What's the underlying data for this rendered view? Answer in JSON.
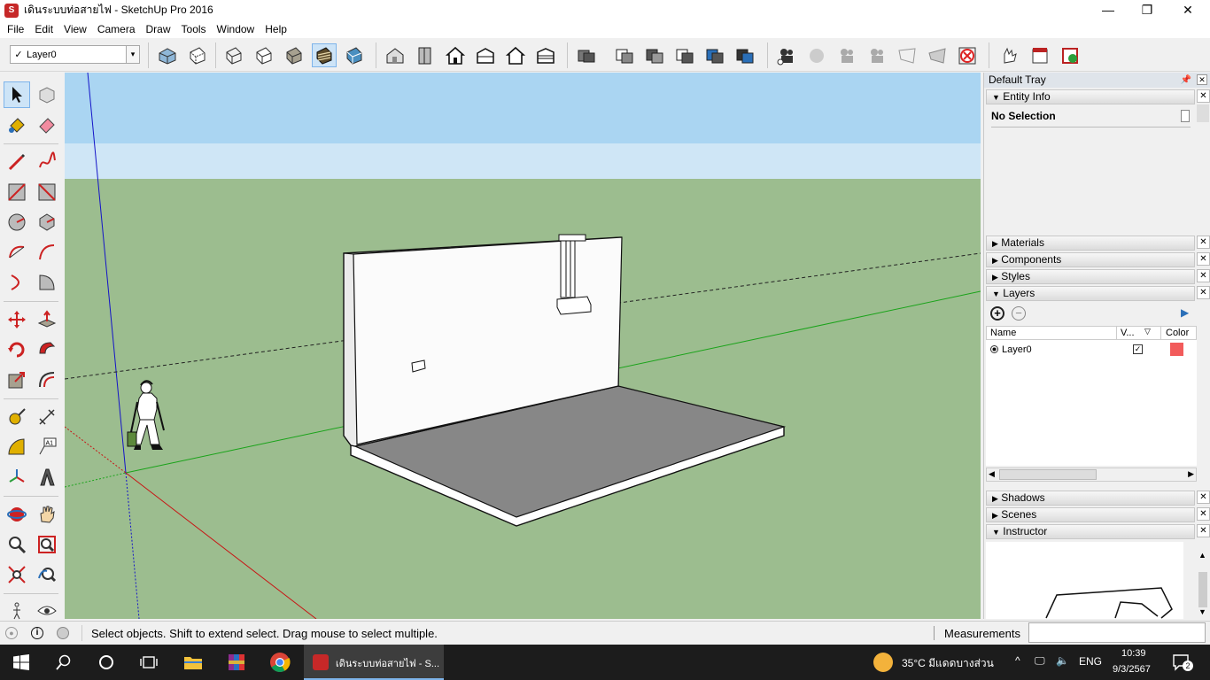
{
  "window": {
    "title": "เดินระบบท่อสายไฟ - SketchUp Pro 2016",
    "minimize": "—",
    "maximize": "❐",
    "close": "✕"
  },
  "menu": [
    "File",
    "Edit",
    "View",
    "Camera",
    "Draw",
    "Tools",
    "Window",
    "Help"
  ],
  "layer_toolbar": {
    "check": "✓",
    "current_layer": "Layer0",
    "dropdown": "▾"
  },
  "tray": {
    "title": "Default Tray",
    "entity_info": {
      "header": "Entity Info",
      "selection": "No Selection"
    },
    "panels": {
      "materials": "Materials",
      "components": "Components",
      "styles": "Styles",
      "layers": "Layers",
      "shadows": "Shadows",
      "scenes": "Scenes",
      "instructor": "Instructor"
    },
    "layers_table": {
      "col_name": "Name",
      "col_visible": "V...",
      "col_color": "Color",
      "rows": [
        {
          "name": "Layer0",
          "visible": true,
          "color": "#f25b5b"
        }
      ]
    }
  },
  "status": {
    "hint": "Select objects. Shift to extend select. Drag mouse to select multiple.",
    "measurements_label": "Measurements",
    "measurements_value": ""
  },
  "taskbar": {
    "active_app": "เดินระบบท่อสายไฟ - S...",
    "weather": "35°C มีแดดบางส่วน",
    "language": "ENG",
    "time": "10:39",
    "date": "9/3/2567",
    "notifications": "2"
  },
  "colors": {
    "sky": "#cfe6f6",
    "ground": "#9cbd8f",
    "layer0": "#f25b5b",
    "taskbar": "#1c1c1c"
  }
}
